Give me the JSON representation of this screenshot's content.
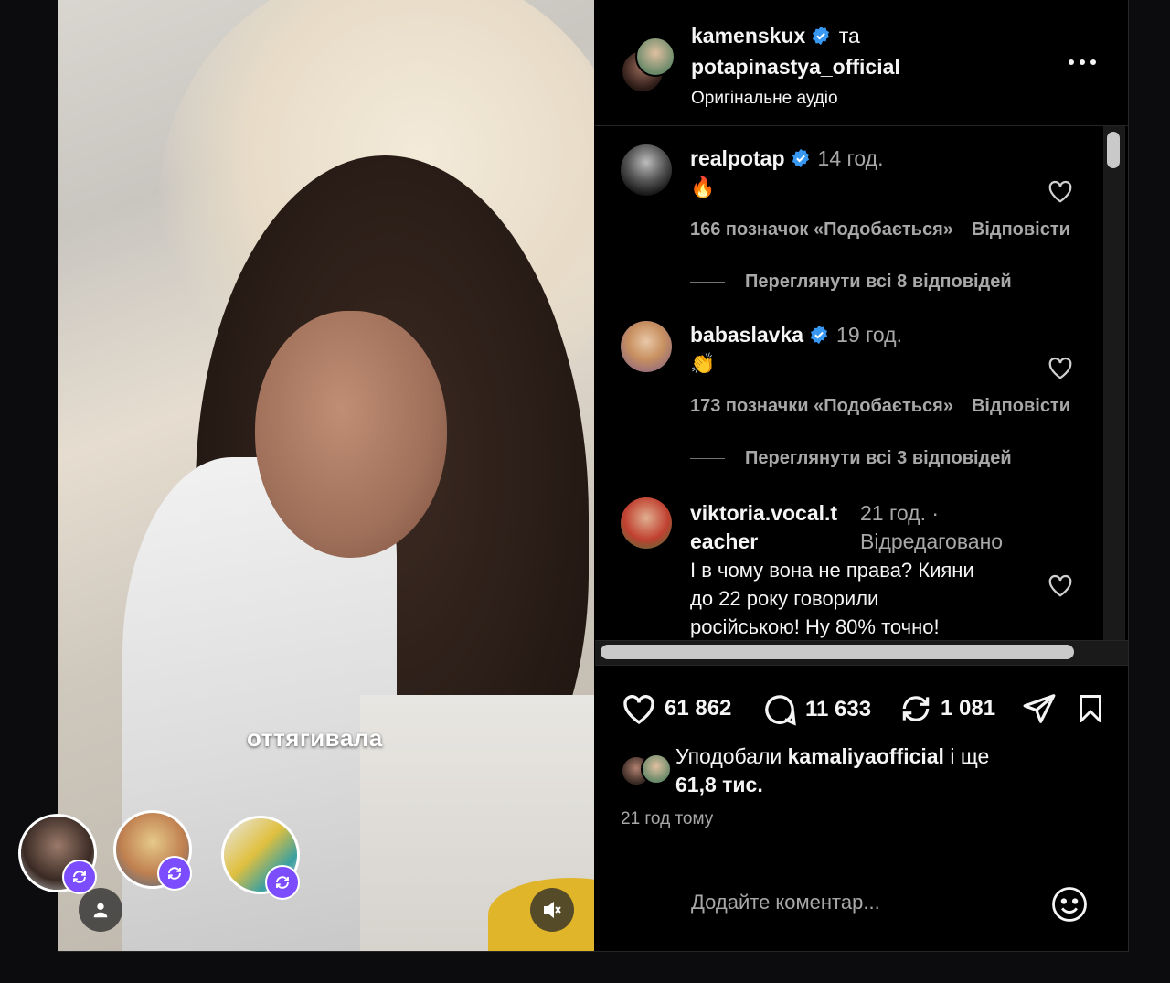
{
  "video": {
    "caption": "оттягивала"
  },
  "header": {
    "user1": "kamenskux",
    "connector": "та",
    "user2": "potapinastya_official",
    "audio": "Оригінальне аудіо"
  },
  "comments": [
    {
      "user": "realpotap",
      "time": "14 год.",
      "text": "🔥",
      "likes": "166 позначок «Подобається»",
      "reply": "Відповісти",
      "view_replies": "Переглянути всі 8 відповідей"
    },
    {
      "user": "babaslavka",
      "time": "19 год.",
      "text": "👏",
      "likes": "173 позначки «Подобається»",
      "reply": "Відповісти",
      "view_replies": "Переглянути всі 3 відповідей"
    },
    {
      "user_line1": "viktoria.vocal.t",
      "user_line2": "eacher",
      "time": "21 год. ·",
      "edited": "Відредаговано",
      "text_line1": "І в чому вона не права? Кияни",
      "text_line2": "до 22 року говорили",
      "text_line3": "російською! Ну 80% точно!"
    }
  ],
  "actions": {
    "likes": "61 862",
    "comments": "11 633",
    "reposts": "1 081"
  },
  "liked_by": {
    "prefix": "Уподобали",
    "user": "kamaliyaofficial",
    "suffix": "і ще",
    "count": "61,8 тис."
  },
  "posted_ago": "21 год тому",
  "add_comment_placeholder": "Додайте коментар...",
  "colors": {
    "verified": "#3897f0",
    "repost_badge": "#7c4dff"
  }
}
